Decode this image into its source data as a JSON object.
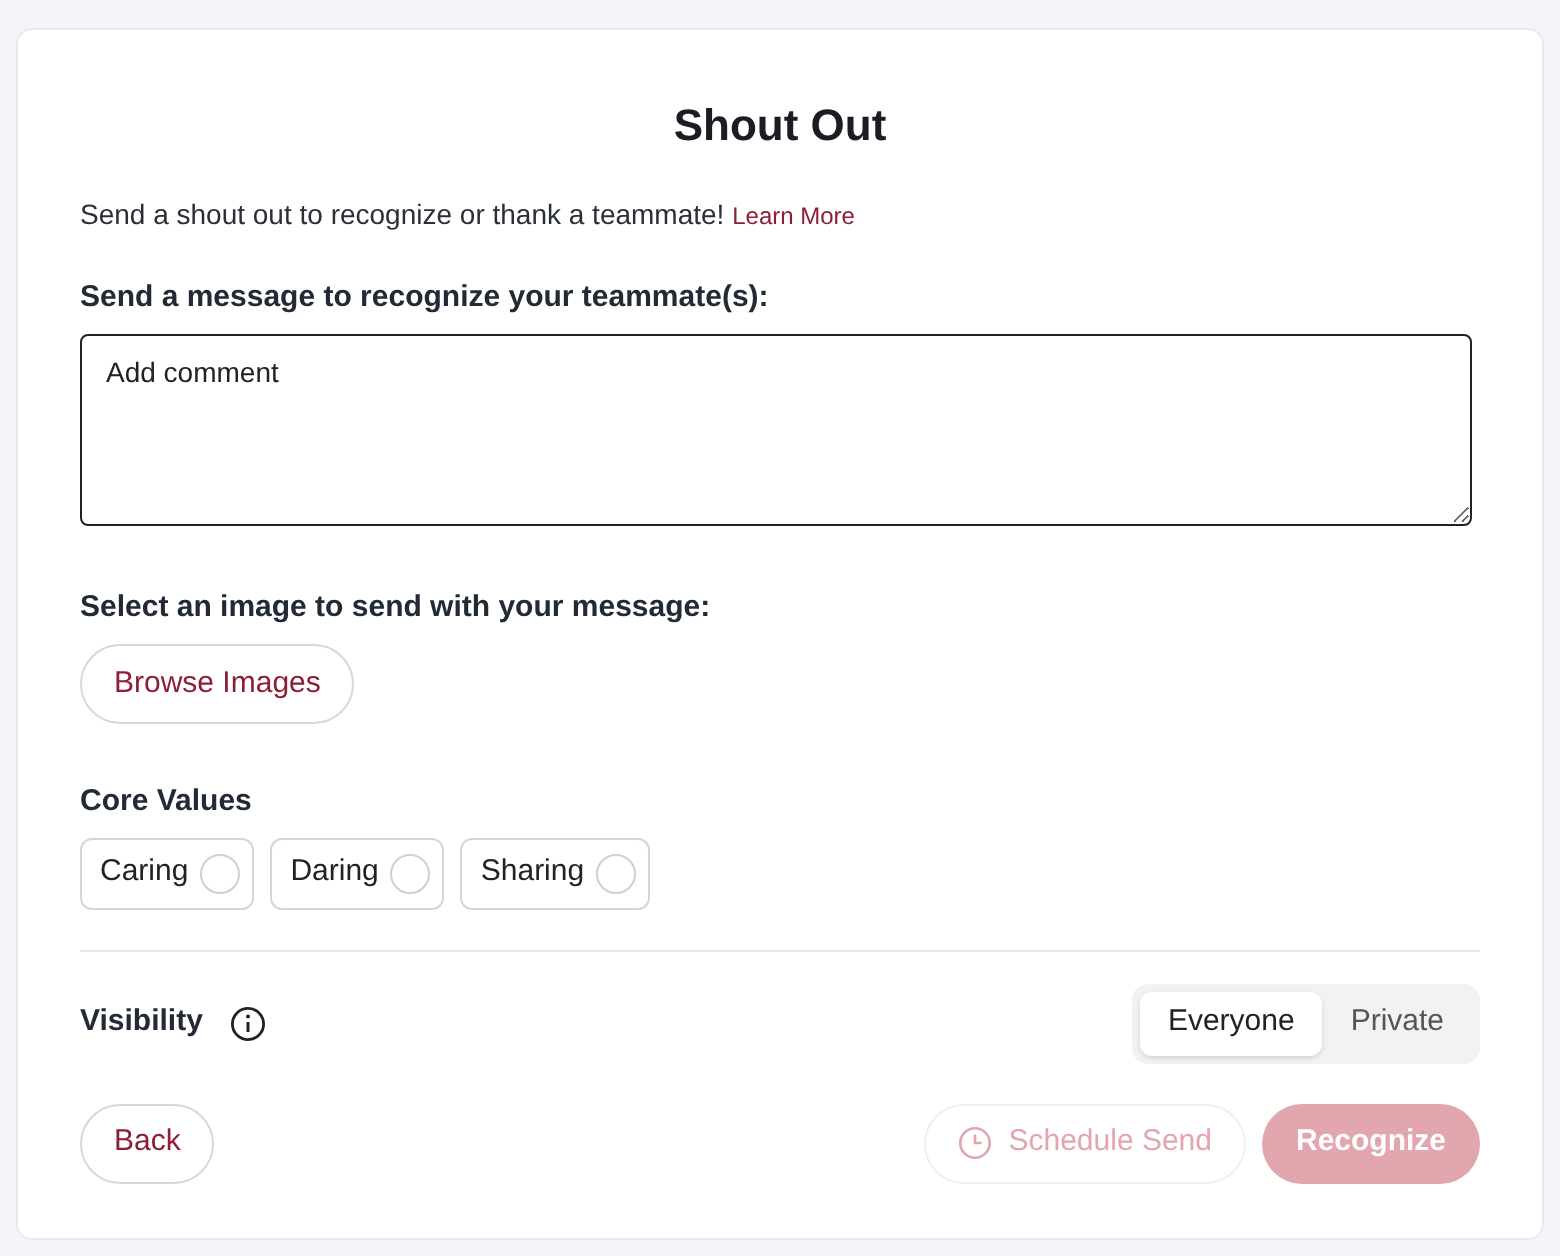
{
  "title": "Shout Out",
  "intro": {
    "text": "Send a shout out to recognize or thank a teammate!",
    "link": "Learn More"
  },
  "message": {
    "label": "Send a message to recognize your teammate(s):",
    "placeholder": "Add comment"
  },
  "image": {
    "label": "Select an image to send with your message:",
    "button": "Browse Images"
  },
  "core_values": {
    "label": "Core Values",
    "items": [
      {
        "label": "Caring",
        "checked": false
      },
      {
        "label": "Daring",
        "checked": false
      },
      {
        "label": "Sharing",
        "checked": false
      }
    ]
  },
  "visibility": {
    "label": "Visibility",
    "options": [
      {
        "label": "Everyone",
        "selected": true
      },
      {
        "label": "Private",
        "selected": false
      }
    ]
  },
  "buttons": {
    "back": "Back",
    "schedule": {
      "label": "Schedule Send",
      "disabled": true
    },
    "recognize": {
      "label": "Recognize",
      "disabled": true
    }
  }
}
